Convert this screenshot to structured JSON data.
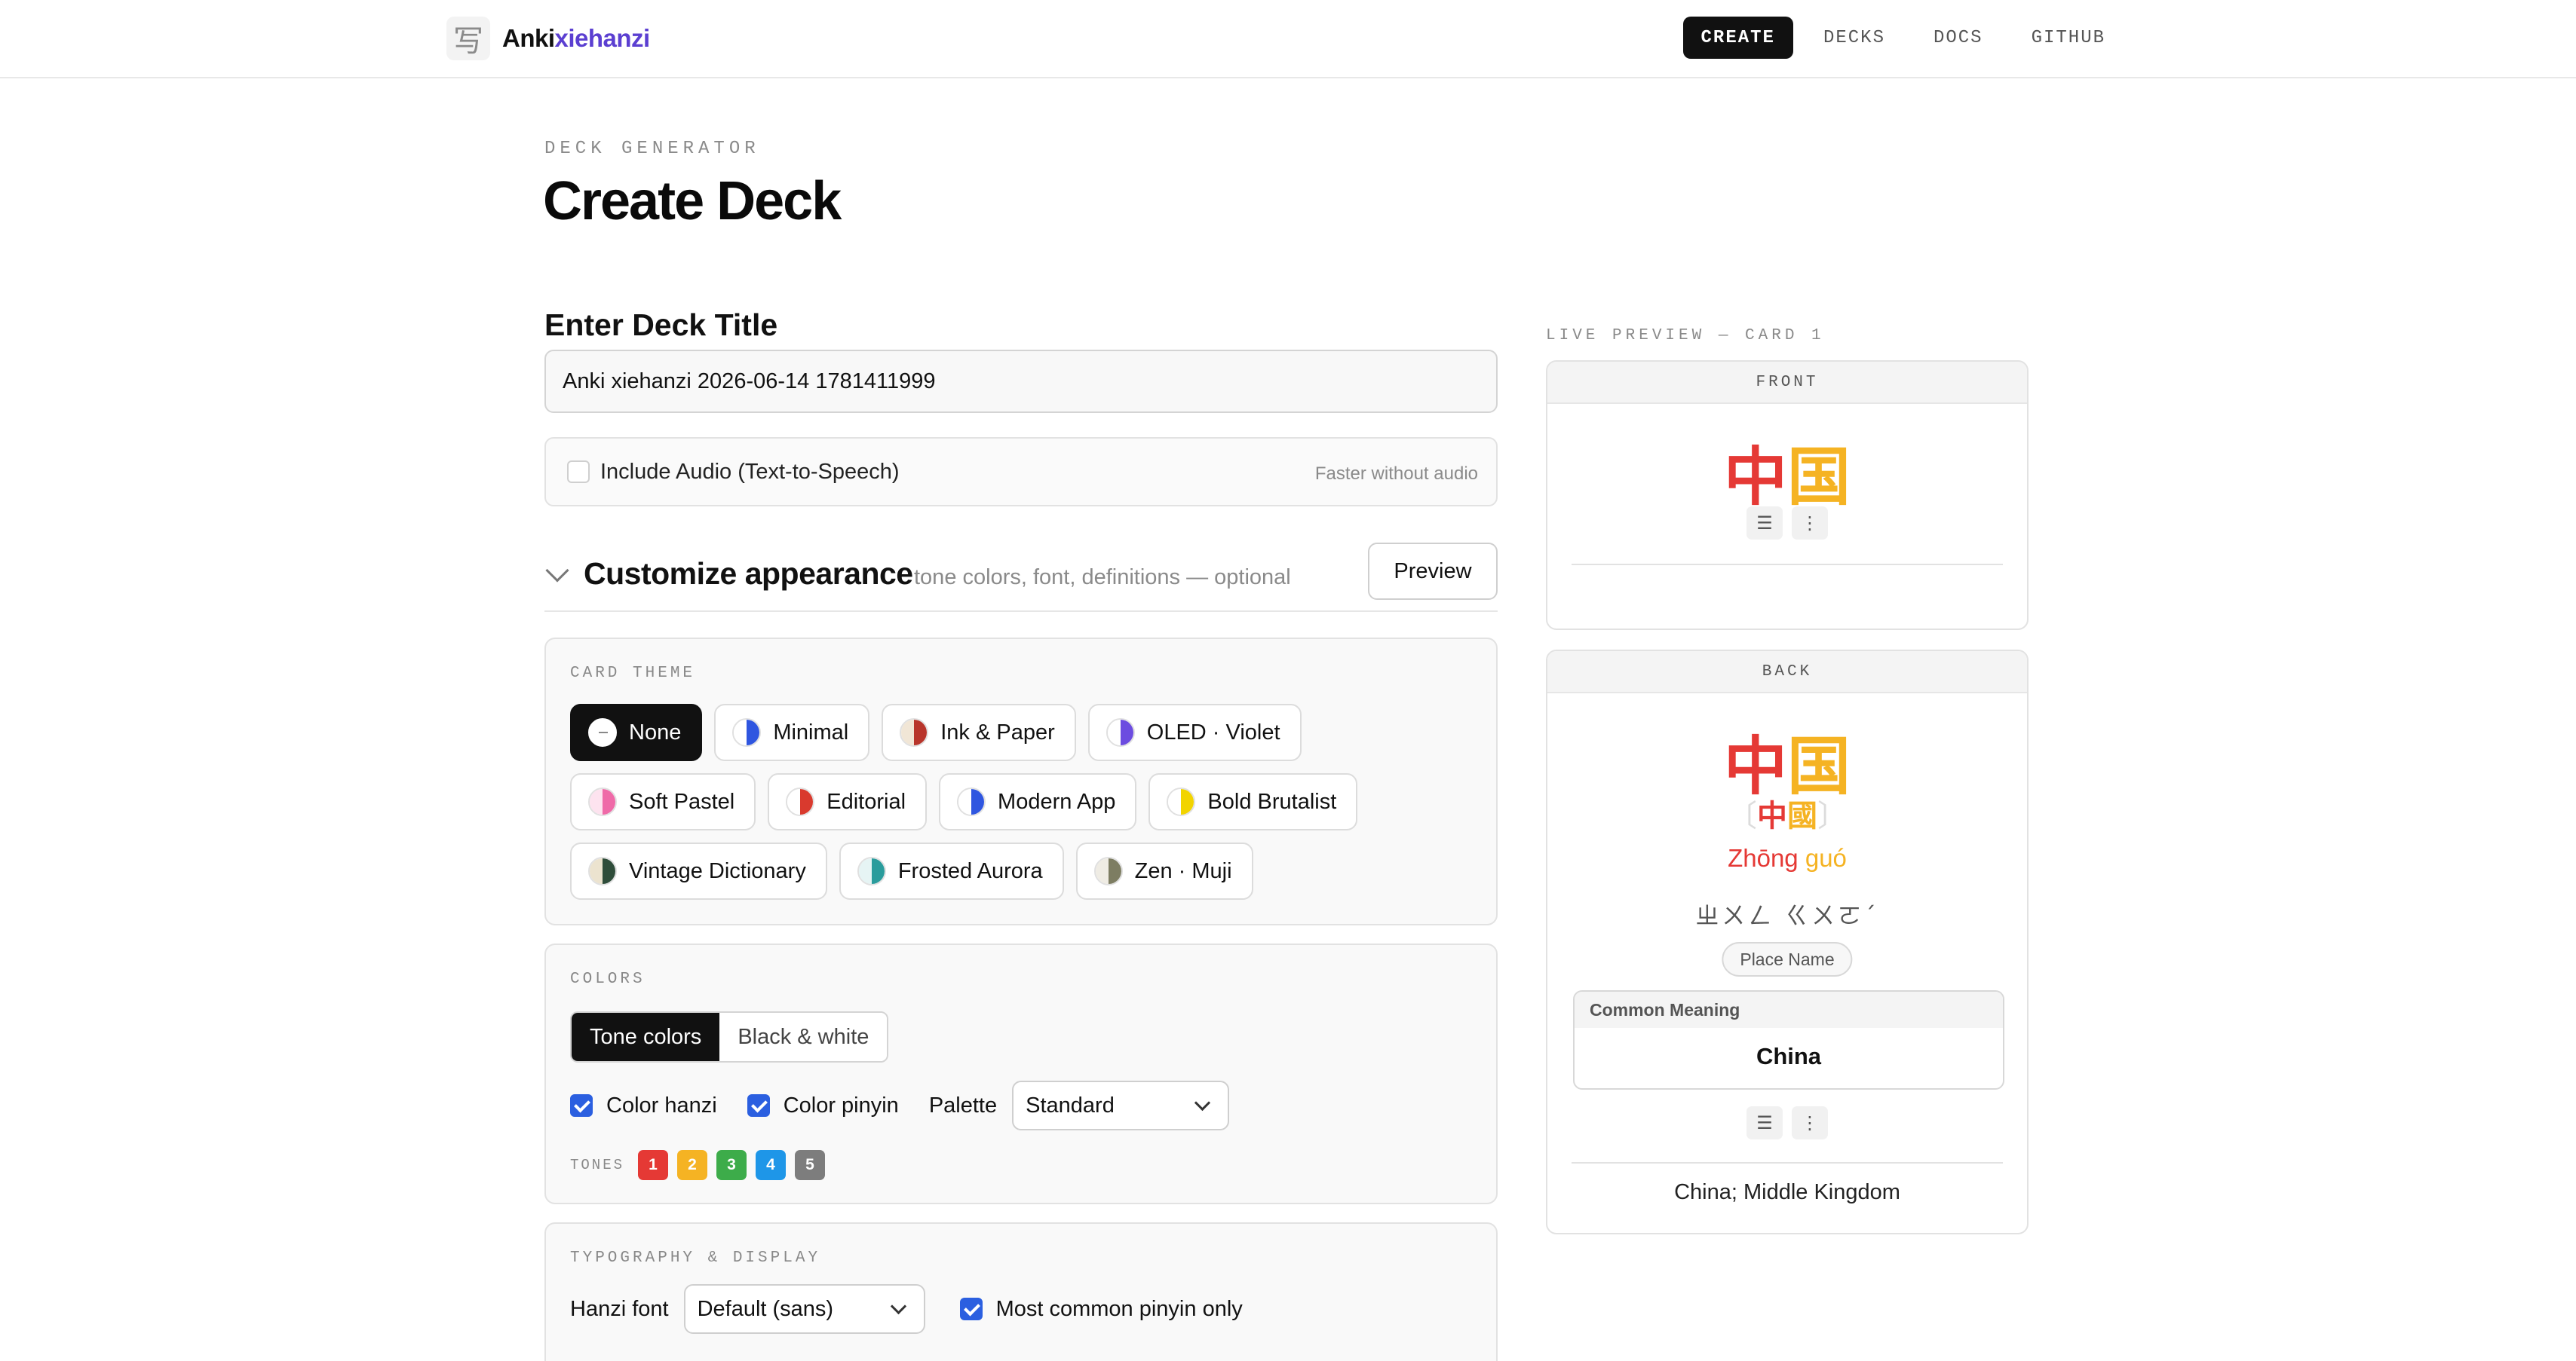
{
  "nav": {
    "brand_icon": "写",
    "brand_a": "Anki",
    "brand_b": "xiehanzi",
    "links": [
      "CREATE",
      "DECKS",
      "DOCS",
      "GITHUB"
    ]
  },
  "header": {
    "eyebrow": "DECK GENERATOR",
    "title": "Create Deck"
  },
  "form": {
    "title_label": "Enter Deck Title",
    "title_value": "Anki xiehanzi 2026-06-14 1781411999",
    "audio_label": "Include Audio (Text-to-Speech)",
    "audio_hint": "Faster without audio",
    "audio_checked": false
  },
  "customize": {
    "title": "Customize appearance",
    "subtitle": "tone colors, font, definitions — optional",
    "preview_label": "Preview"
  },
  "theme": {
    "title": "CARD THEME",
    "row1": [
      "None",
      "Minimal",
      "Ink & Paper",
      "OLED · Violet"
    ],
    "row2": [
      "Soft Pastel",
      "Editorial",
      "Modern App",
      "Bold Brutalist"
    ],
    "row3": [
      "Vintage Dictionary",
      "Frosted Aurora",
      "Zen · Muji"
    ],
    "selected": "None",
    "swatch_colors": {
      "Minimal": [
        "#ffffff",
        "#2f56e0"
      ],
      "Ink & Paper": [
        "#f1e6d6",
        "#b8352b"
      ],
      "OLED · Violet": [
        "#ffffff",
        "#6c4ce0"
      ],
      "Soft Pastel": [
        "#fde3ef",
        "#ef6aa8"
      ],
      "Editorial": [
        "#ffffff",
        "#d93a2e"
      ],
      "Modern App": [
        "#ffffff",
        "#2f56e0"
      ],
      "Bold Brutalist": [
        "#ffffff",
        "#f2d400"
      ],
      "Vintage Dictionary": [
        "#ece3cf",
        "#2f4d3a"
      ],
      "Frosted Aurora": [
        "#e6f4f4",
        "#2a9c9c"
      ],
      "Zen · Muji": [
        "#efece4",
        "#7d7d62"
      ]
    }
  },
  "colors": {
    "title": "COLORS",
    "seg": [
      "Tone colors",
      "Black & white"
    ],
    "color_hanzi": "Color hanzi",
    "color_pinyin": "Color pinyin",
    "palette_label": "Palette",
    "palette_value": "Standard",
    "tones_label": "TONES",
    "tones": [
      "1",
      "2",
      "3",
      "4",
      "5"
    ],
    "tone_colors": [
      "#e53935",
      "#f5b323",
      "#3dac4a",
      "#1e96e8",
      "#7d7d7d"
    ]
  },
  "typography": {
    "title": "TYPOGRAPHY & DISPLAY",
    "hanzi_font_label": "Hanzi font",
    "hanzi_font_value": "Default (sans)",
    "common_pinyin_label": "Most common pinyin only"
  },
  "preview": {
    "eyebrow": "LIVE PREVIEW — CARD 1",
    "front_label": "FRONT",
    "back_label": "BACK",
    "hanzi_1": "中",
    "hanzi_2": "国",
    "bracket_l": "〔",
    "bracket_r": "〕",
    "trad_1": "中",
    "trad_2": "國",
    "pinyin_1": "Zhōng",
    "pinyin_2": "guó",
    "zhuyin": "ㄓㄨㄥ ㄍㄨㄛˊ",
    "tag": "Place Name",
    "meaning_label": "Common Meaning",
    "meaning_value": "China",
    "definition": "China; Middle Kingdom",
    "tool_icons": [
      "☰",
      "⋮"
    ],
    "tone1_color": "#e53935",
    "tone2_color": "#f5b323"
  }
}
